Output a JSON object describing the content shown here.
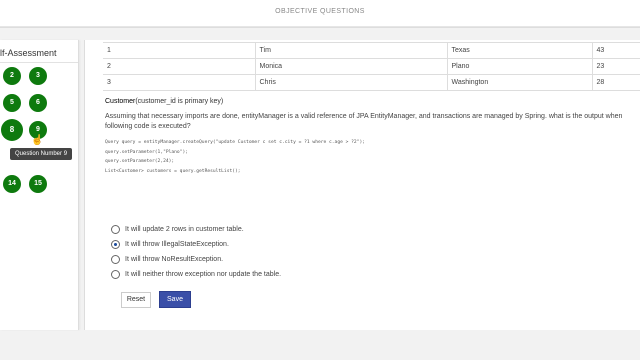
{
  "header": {
    "title": "OBJECTIVE QUESTIONS"
  },
  "sidebar": {
    "title": "lf-Assessment",
    "questions": [
      "2",
      "3",
      "5",
      "6",
      "8",
      "9",
      "14",
      "15"
    ],
    "tooltip": "Question Number 9"
  },
  "table": {
    "rows": [
      [
        "1",
        "Tim",
        "Texas",
        "43"
      ],
      [
        "2",
        "Monica",
        "Plano",
        "23"
      ],
      [
        "3",
        "Chris",
        "Washington",
        "28"
      ]
    ]
  },
  "entity": {
    "name": "Customer",
    "note": "(customer_id is primary key)"
  },
  "question": {
    "text": "Assuming that necessary imports are done, entityManager is a valid reference of JPA EntityManager, and transactions are managed by Spring. what is the output when following code is executed?"
  },
  "code": {
    "lines": [
      "Query query = entityManager.createQuery(\"update Customer c set c.city = ?1 where c.age > ?2\");",
      "query.setParameter(1,\"Plano\");",
      "query.setParameter(2,24);",
      "List<Customer> customers = query.getResultList();"
    ]
  },
  "options": [
    {
      "label": "It will update 2 rows in customer table.",
      "selected": false
    },
    {
      "label": "It will throw IllegalStateException.",
      "selected": true
    },
    {
      "label": "It will throw NoResultException.",
      "selected": false
    },
    {
      "label": "It will neither throw exception nor update the table.",
      "selected": false
    }
  ],
  "actions": {
    "reset_label": "Reset",
    "save_label": "Save"
  },
  "colors": {
    "question_button": "#0e7a0e",
    "save_button": "#3a4fa8"
  }
}
